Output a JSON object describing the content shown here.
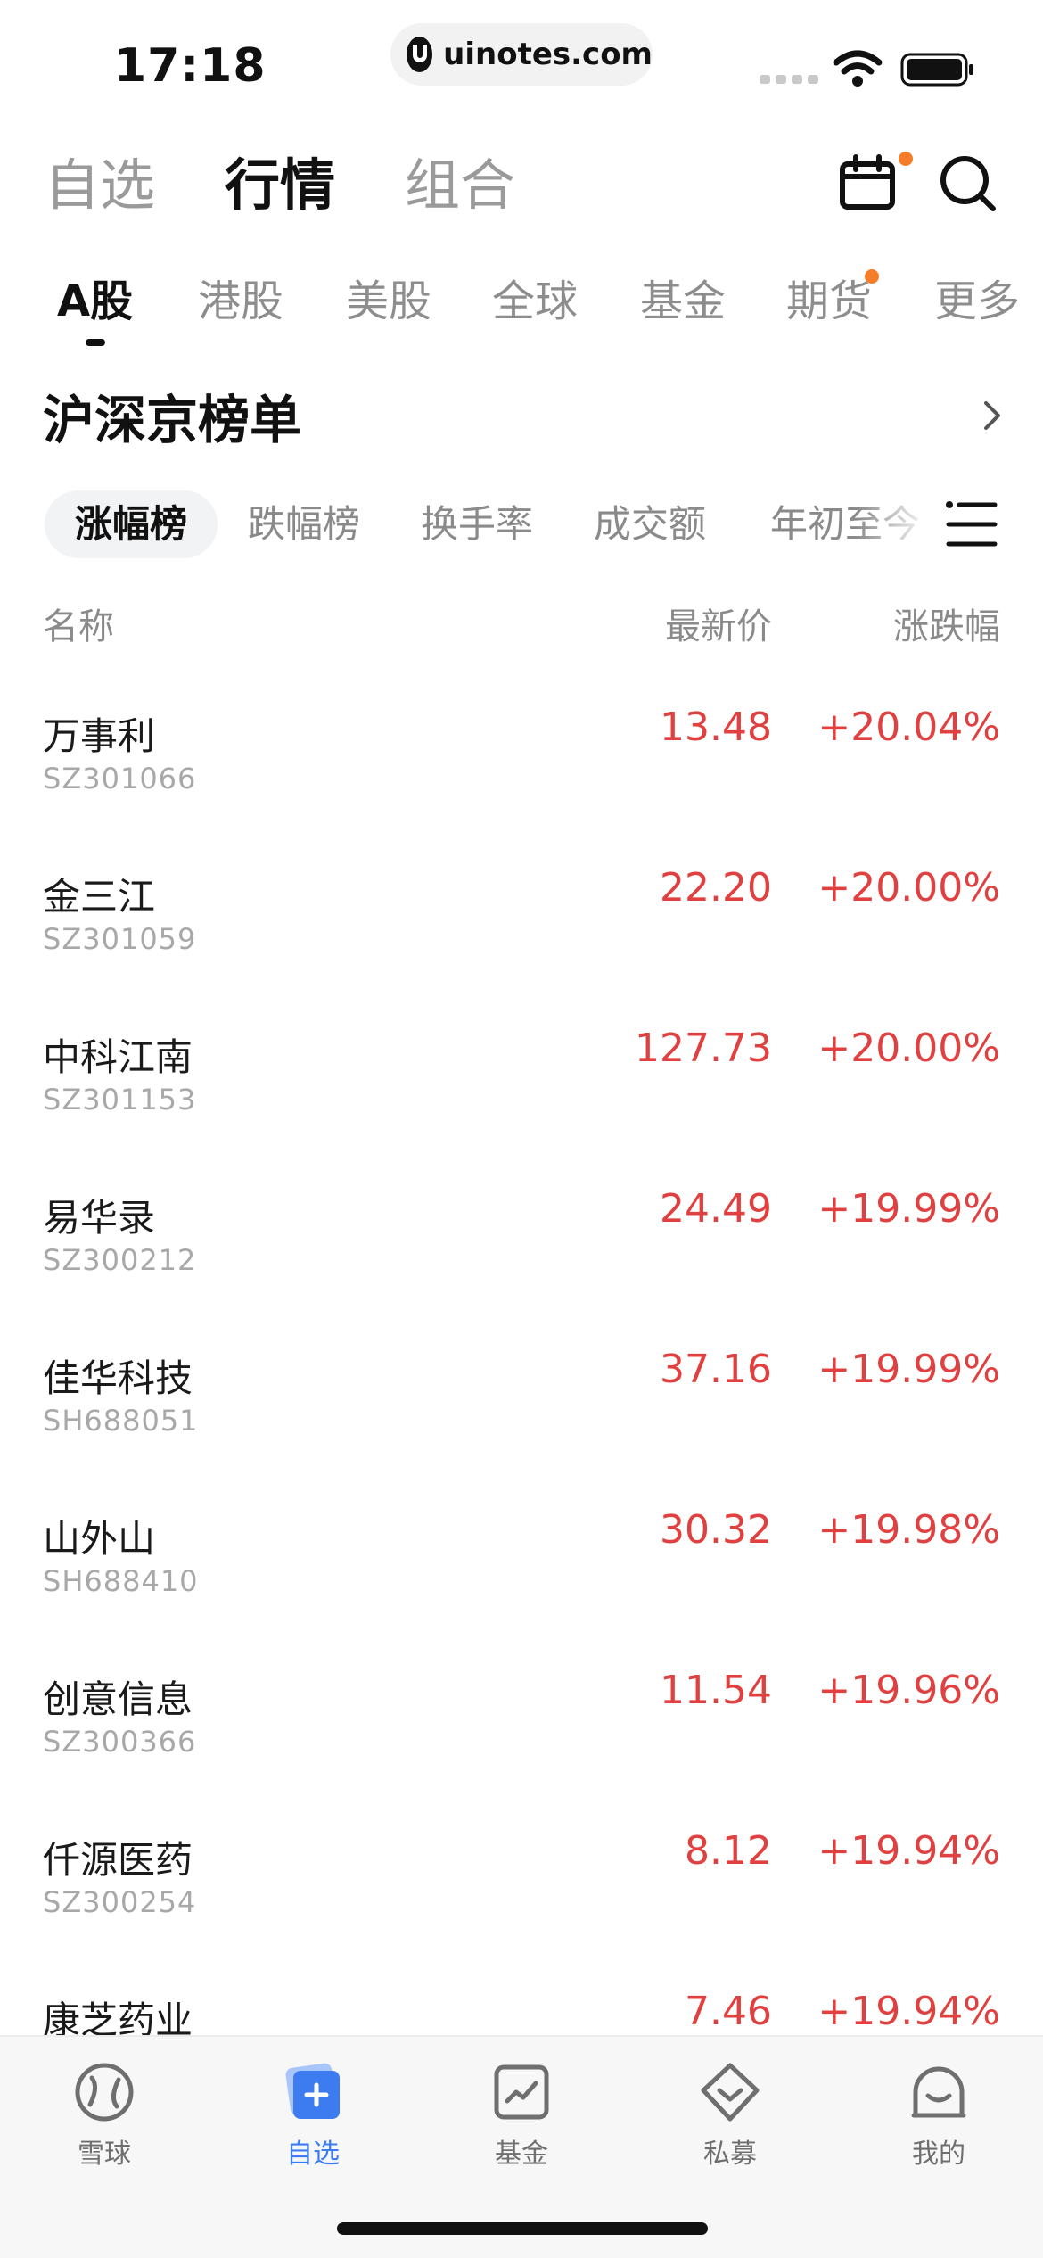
{
  "status_bar": {
    "time": "17:18",
    "url": "uinotes.com"
  },
  "top_nav": {
    "tabs": [
      "自选",
      "行情",
      "组合"
    ],
    "active_tab": "行情",
    "icons": [
      "calendar-icon",
      "search-icon"
    ]
  },
  "market_tabs": {
    "items": [
      "A股",
      "港股",
      "美股",
      "全球",
      "基金",
      "期货",
      "更多"
    ],
    "active": "A股"
  },
  "section": {
    "title": "沪深京榜单"
  },
  "rank_tabs": {
    "items": [
      "涨幅榜",
      "跌幅榜",
      "换手率",
      "成交额",
      "年初至今"
    ],
    "active": "涨幅榜"
  },
  "table": {
    "headers": {
      "name": "名称",
      "price": "最新价",
      "change": "涨跌幅"
    },
    "rows": [
      {
        "name": "万事利",
        "code": "SZ301066",
        "price": "13.48",
        "change": "+20.04%"
      },
      {
        "name": "金三江",
        "code": "SZ301059",
        "price": "22.20",
        "change": "+20.00%"
      },
      {
        "name": "中科江南",
        "code": "SZ301153",
        "price": "127.73",
        "change": "+20.00%"
      },
      {
        "name": "易华录",
        "code": "SZ300212",
        "price": "24.49",
        "change": "+19.99%"
      },
      {
        "name": "佳华科技",
        "code": "SH688051",
        "price": "37.16",
        "change": "+19.99%"
      },
      {
        "name": "山外山",
        "code": "SH688410",
        "price": "30.32",
        "change": "+19.98%"
      },
      {
        "name": "创意信息",
        "code": "SZ300366",
        "price": "11.54",
        "change": "+19.96%"
      },
      {
        "name": "仟源医药",
        "code": "SZ300254",
        "price": "8.12",
        "change": "+19.94%"
      },
      {
        "name": "康芝药业",
        "code": "",
        "price": "7.46",
        "change": "+19.94%"
      }
    ]
  },
  "tabbar": {
    "items": [
      "雪球",
      "自选",
      "基金",
      "私募",
      "我的"
    ],
    "active": "自选"
  },
  "colors": {
    "rise": "#e0403f",
    "accent": "#3d7cf0",
    "notify": "#f47d2a"
  }
}
